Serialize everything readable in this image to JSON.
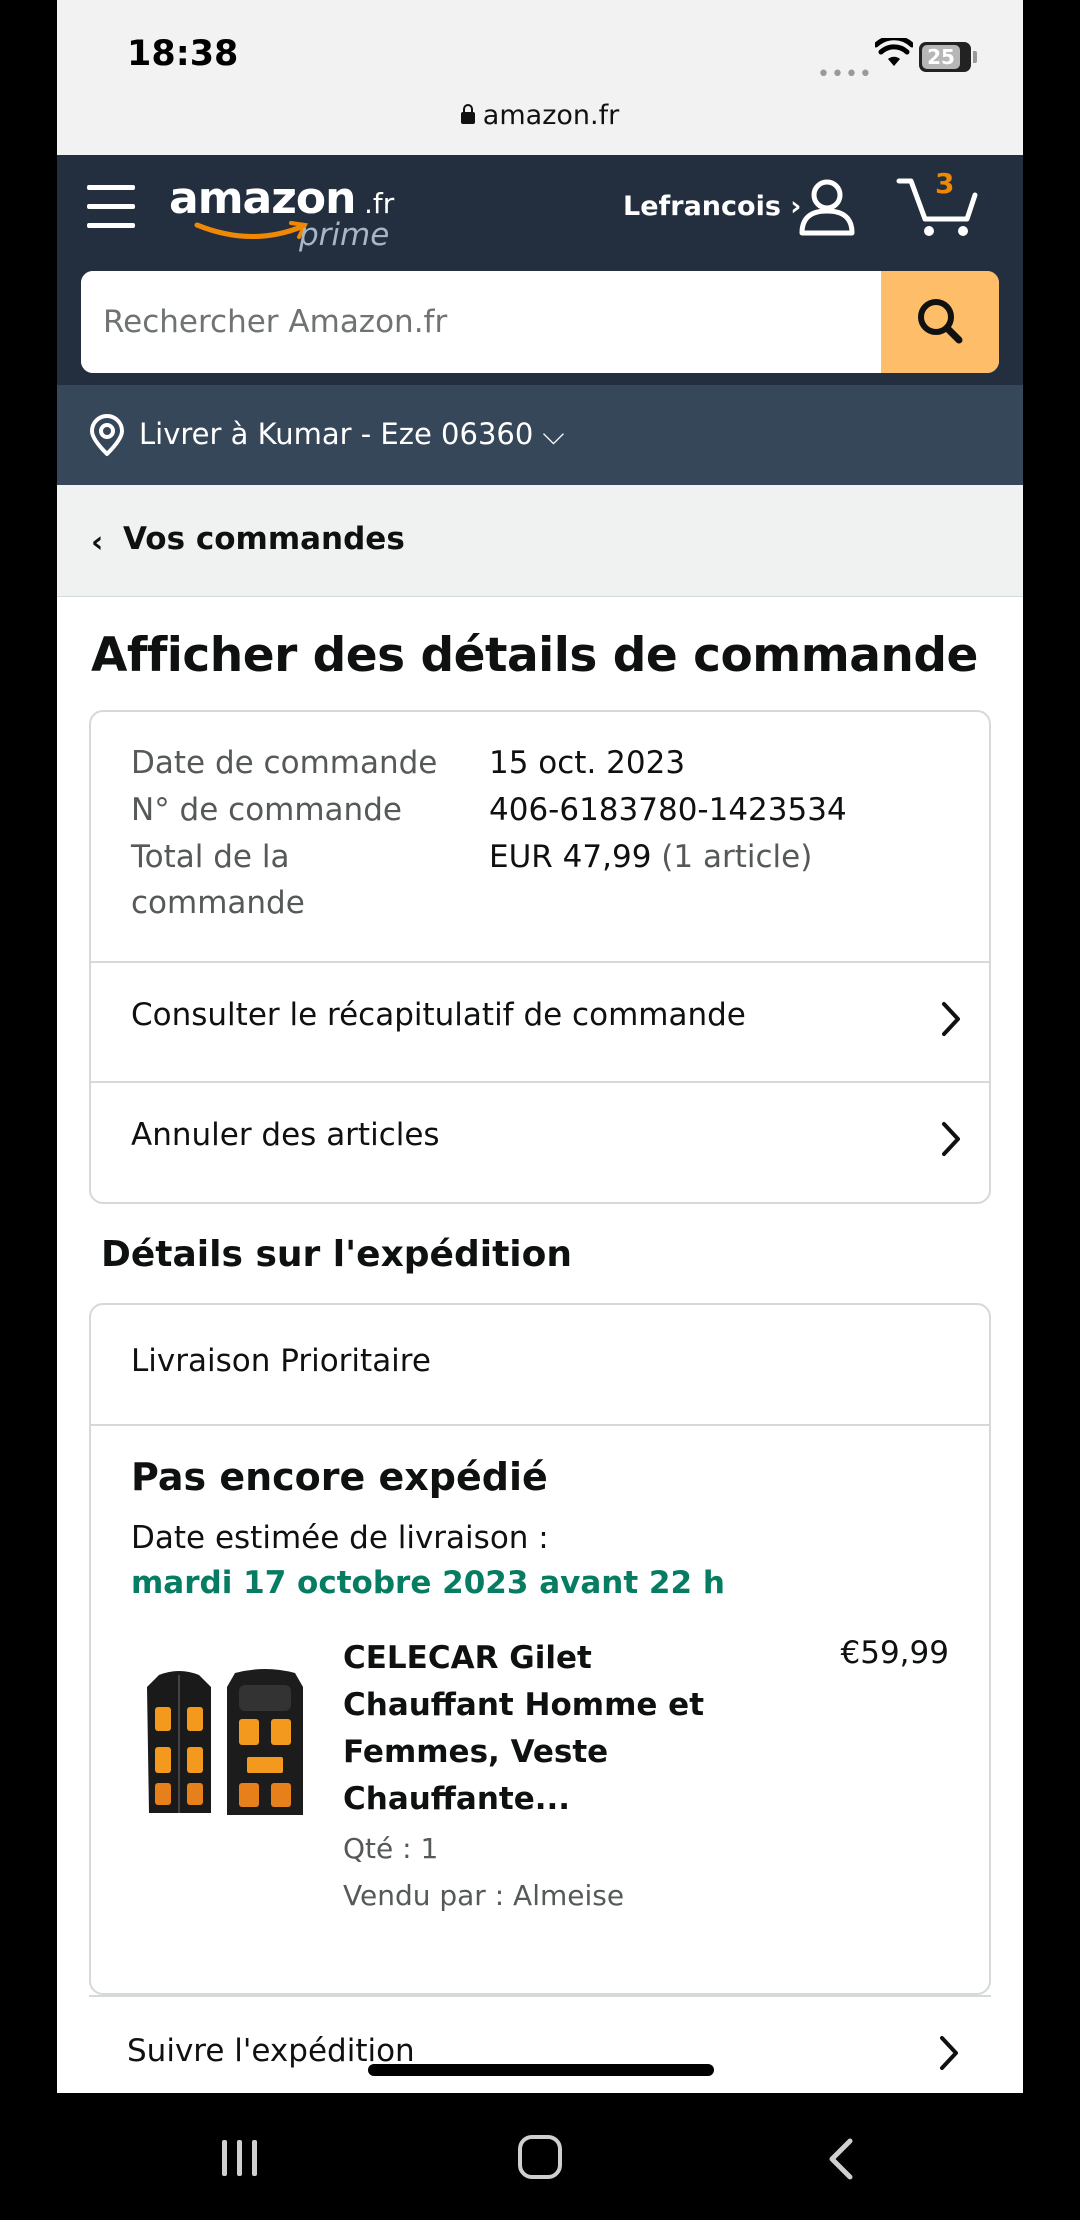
{
  "status_bar": {
    "time": "18:38",
    "battery": "25"
  },
  "browser": {
    "url": "amazon.fr"
  },
  "header": {
    "logo_word": "amazon",
    "logo_tld": ".fr",
    "logo_prime": "prime",
    "account_name": "Lefrancois ›",
    "cart_count": "3",
    "search_placeholder": "Rechercher Amazon.fr",
    "deliver_to": "Livrer à Kumar - Eze 06360 ⌵"
  },
  "breadcrumb": {
    "label": "Vos commandes"
  },
  "page_title": "Afficher des détails de commande",
  "order_summary": {
    "date_label": "Date de commande",
    "date_value": "15 oct. 2023",
    "number_label": "N° de commande",
    "number_value": "406-6183780-1423534",
    "total_label_line1": "Total de la",
    "total_label_line2": "commande",
    "total_value": "EUR 47,99",
    "total_items": "(1 article)"
  },
  "actions": {
    "view_summary": "Consulter le récapitulatif de commande",
    "cancel_items": "Annuler des articles"
  },
  "shipment": {
    "section_title": "Détails sur l'expédition",
    "shipping_type": "Livraison Prioritaire",
    "status": "Pas encore expédié",
    "estimate_label": "Date estimée de livraison :",
    "estimate_date": "mardi 17 octobre 2023 avant 22 h",
    "product": {
      "name": "CELECAR Gilet Chauffant Homme et Femmes, Veste Chauffante...",
      "price": "€59,99",
      "qty": "Qté : 1",
      "seller": "Vendu par : Almeise"
    },
    "track_label": "Suivre l'expédition"
  },
  "colors": {
    "nav_bg": "#232f3e",
    "deliver_bg": "#37475a",
    "search_button": "#febd69",
    "cart_count": "#f08804",
    "delivery_green": "#067d62"
  }
}
